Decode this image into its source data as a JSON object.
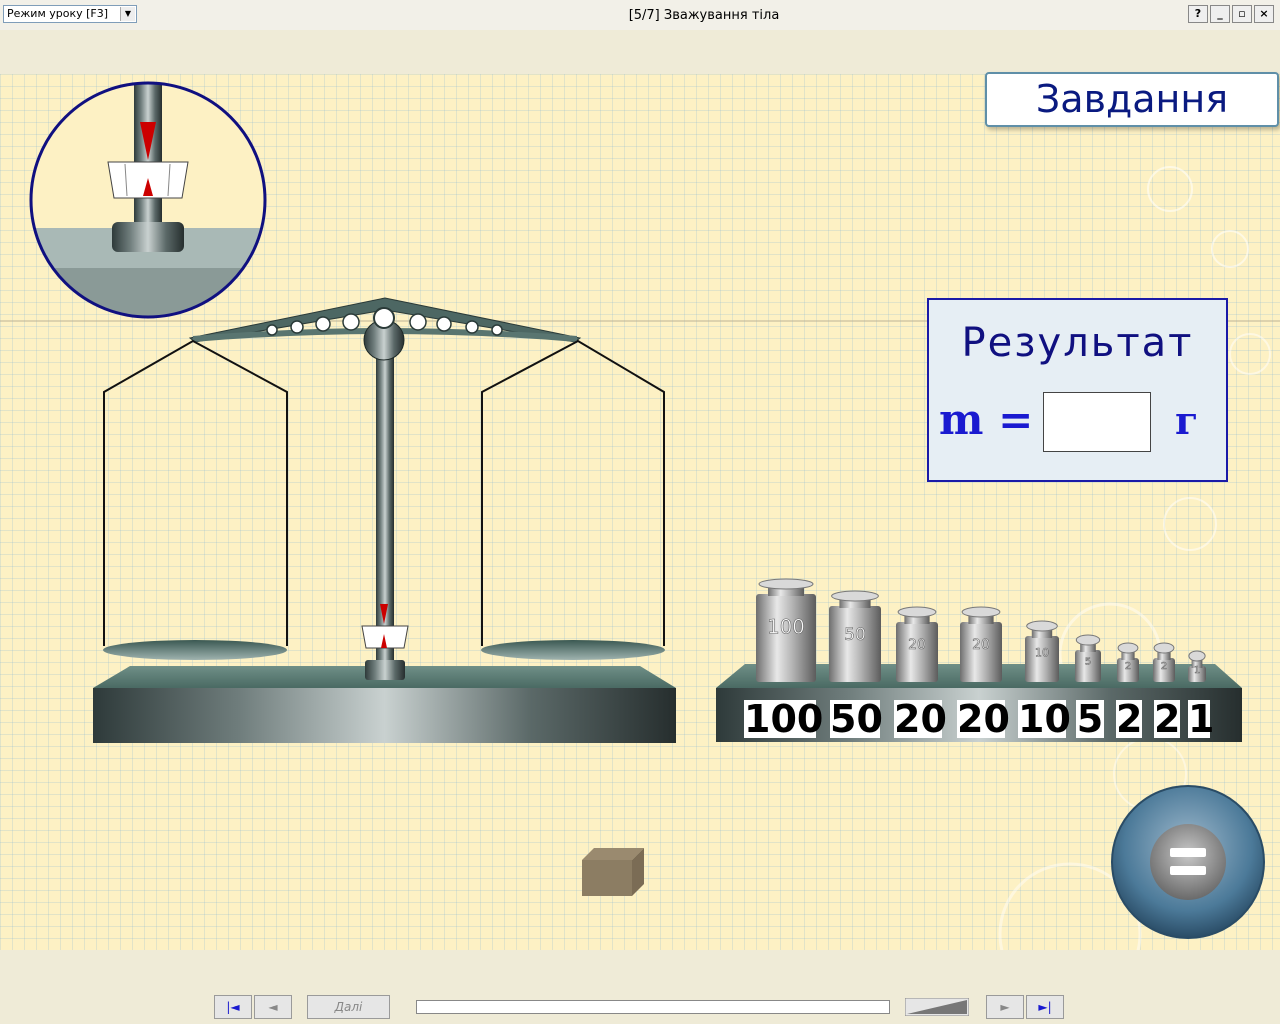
{
  "window": {
    "title": "[5/7] Зважування тіла",
    "mode_select": "Режим уроку  [F3]",
    "buttons": {
      "help": "?",
      "minimize": "_",
      "restore": "▫",
      "close": "×"
    }
  },
  "task_button": "Завдання",
  "result": {
    "title": "Результат",
    "mass_label": "m =",
    "mass_value": "",
    "unit": "г"
  },
  "weights": [
    {
      "label": "100",
      "value": 100
    },
    {
      "label": "50",
      "value": 50
    },
    {
      "label": "20",
      "value": 20
    },
    {
      "label": "20",
      "value": 20
    },
    {
      "label": "10",
      "value": 10
    },
    {
      "label": "5",
      "value": 5
    },
    {
      "label": "2",
      "value": 2
    },
    {
      "label": "2",
      "value": 2
    },
    {
      "label": "1",
      "value": 1
    }
  ],
  "equals_button": "=",
  "bottom_nav": {
    "first": "|◄",
    "prev": "◄",
    "next_text": "Далі",
    "next": "►",
    "last": "►|"
  },
  "colors": {
    "background": "#fdf1c4",
    "panel_border": "#1a1aa8",
    "text_blue": "#1a1ad0",
    "pointer_red": "#cc0000"
  }
}
